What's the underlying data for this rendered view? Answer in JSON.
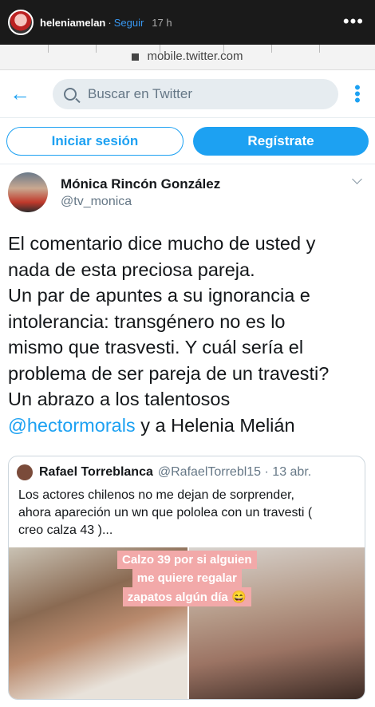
{
  "story": {
    "username": "heleniamelan",
    "separator": "·",
    "follow_label": "Seguir",
    "time": "17 h",
    "more_label": "•••"
  },
  "browser": {
    "url": "mobile.twitter.com"
  },
  "twitter": {
    "back_icon": "arrow-left-icon",
    "search_placeholder": "Buscar en Twitter",
    "menu_label": "⋮",
    "login_label": "Iniciar sesión",
    "signup_label": "Regístrate",
    "accent_color": "#1da1f2"
  },
  "tweet": {
    "author_name": "Mónica Rincón González",
    "author_handle": "@tv_monica",
    "lines": [
      "El comentario dice mucho de usted y",
      "nada de esta preciosa pareja.",
      "Un par de apuntes a su ignorancia e",
      "intolerancia: transgénero no es lo",
      "mismo que trasvesti. Y cuál sería el",
      "problema de ser pareja de un travesti?",
      "Un abrazo a los talentosos"
    ],
    "mention": "@hectormorals",
    "last_line_rest": " y a Helenia Melián"
  },
  "quote": {
    "author_name": "Rafael Torreblanca",
    "author_handle": "@RafaelTorrebl15 · 13 abr.",
    "lines": [
      "Los actores chilenos no me dejan de sorprender,",
      "ahora apareción un wn que pololea con un travesti (",
      "creo calza 43 )..."
    ],
    "sticker_lines": [
      "Calzo 39 por si alguien",
      "me quiere regalar",
      "zapatos algún día 😄"
    ]
  }
}
